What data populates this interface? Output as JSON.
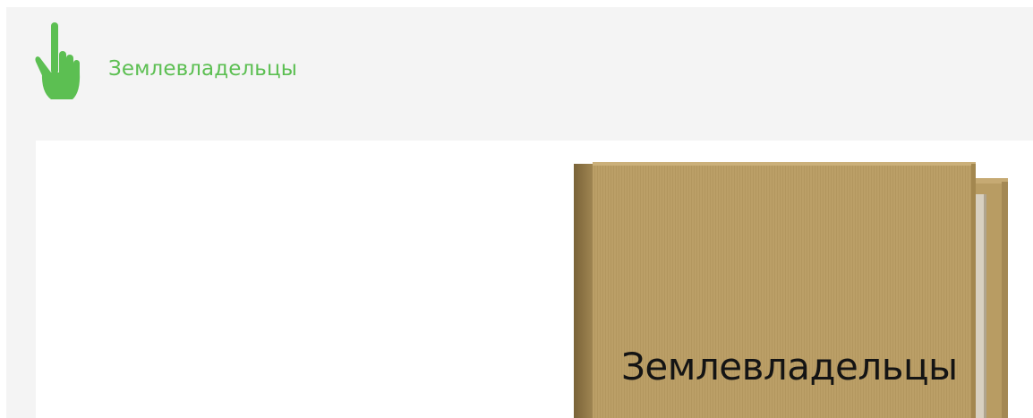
{
  "header": {
    "link_label": "Землевладельцы",
    "icon": "pointing-hand-icon"
  },
  "folder": {
    "title": "Землевладельцы",
    "icon": "folder-icon"
  },
  "colors": {
    "accent_green": "#5cbf52",
    "panel_background": "#f4f4f4",
    "folder_cover": "#bb9f67",
    "folder_spine": "#8c7444"
  }
}
